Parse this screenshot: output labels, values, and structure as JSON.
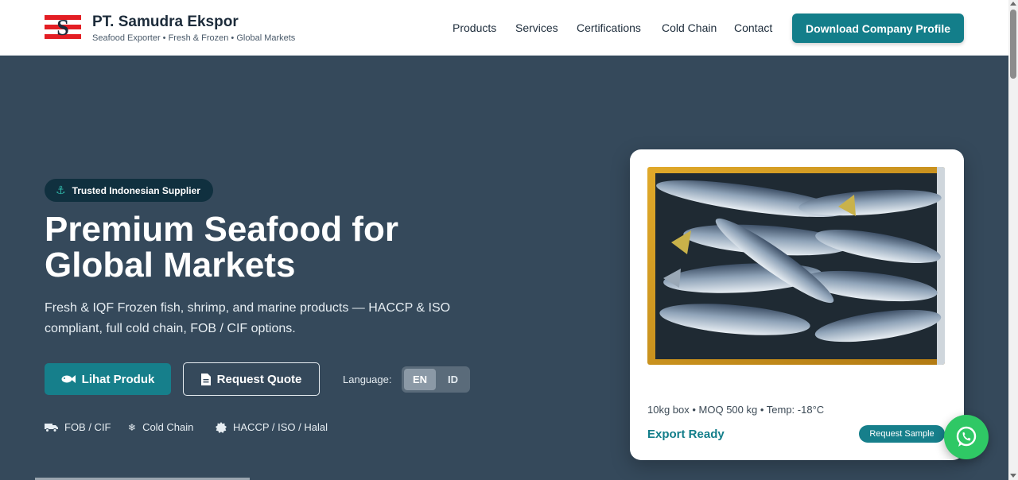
{
  "brand": {
    "name": "PT. Samudra Ekspor",
    "tagline": "Seafood Exporter • Fresh & Frozen • Global Markets",
    "logo_letter": "S"
  },
  "nav": {
    "items": [
      "Products",
      "Services",
      "Certifications",
      "Cold Chain",
      "Contact"
    ],
    "cta": "Download Company Profile"
  },
  "hero": {
    "badge": "Trusted Indonesian Supplier",
    "title": "Premium Seafood for Global Markets",
    "subtitle": "Fresh & IQF Frozen fish, shrimp, and marine products — HACCP & ISO compliant, full cold chain, FOB / CIF options.",
    "primary_button": "Lihat Produk",
    "secondary_button": "Request Quote",
    "language_label": "Language:",
    "languages": [
      "EN",
      "ID"
    ],
    "selected_language": "EN",
    "features": [
      "FOB / CIF",
      "Cold Chain",
      "HACCP / ISO / Halal"
    ]
  },
  "card": {
    "meta": "10kg box • MOQ 500 kg • Temp: -18°C",
    "status": "Export Ready",
    "button": "Request Sample"
  },
  "colors": {
    "accent": "#137e8a",
    "hero_bg": "#35495b",
    "badge_bg": "#10303f",
    "whatsapp": "#2fc865",
    "logo_red": "#e31e24"
  },
  "icons": {
    "badge": "anchor-icon",
    "primary_button": "fish-icon",
    "secondary_button": "document-icon",
    "features": [
      "truck-icon",
      "snowflake-icon",
      "certificate-icon"
    ],
    "floating": "whatsapp-icon"
  }
}
